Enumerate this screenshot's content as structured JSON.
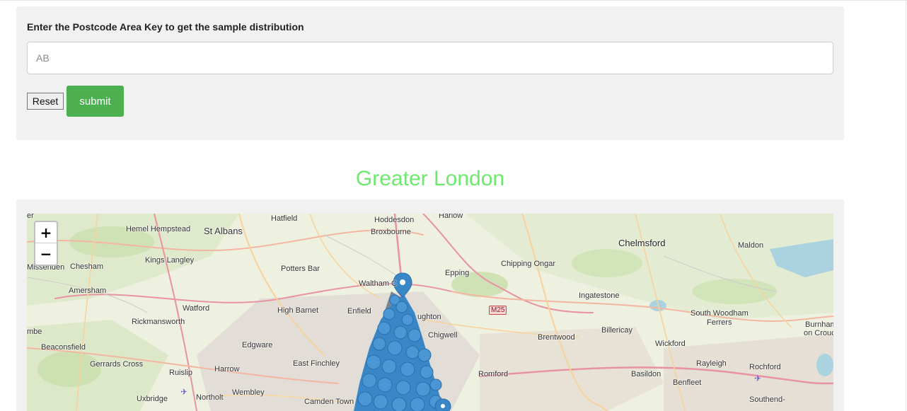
{
  "form": {
    "label": "Enter the Postcode Area Key to get the sample distribution",
    "input_placeholder": "AB",
    "input_value": "",
    "reset_label": "Reset",
    "submit_label": "submit"
  },
  "region_title": "Greater London",
  "colors": {
    "title": "#6ee86e",
    "submit": "#4caf50",
    "marker": "#3a87c8"
  },
  "map": {
    "zoom_in": "+",
    "zoom_out": "−",
    "road_label": "M25",
    "places": {
      "harlow": "Harlow",
      "hoddesdon": "Hoddesdon",
      "hatfield": "Hatfield",
      "hemel": "Hemel Hempstead",
      "st_albans": "St Albans",
      "broxbourne": "Broxbourne",
      "chelmsford": "Chelmsford",
      "maldon": "Maldon",
      "er": "er",
      "kings_langley": "Kings Langley",
      "missenden": "Missenden",
      "chesham": "Chesham",
      "potters_bar": "Potters Bar",
      "epping": "Epping",
      "chipping_ongar": "Chipping Ongar",
      "waltham": "Waltham C",
      "amersham": "Amersham",
      "ingatestone": "Ingatestone",
      "watford": "Watford",
      "high_barnet": "High Barnet",
      "enfield": "Enfield",
      "loughton": "ughton",
      "south_woodham": "South Woodham",
      "ferrers": "Ferrers",
      "burnham": "Burnham",
      "on_crouch": "on Crouch",
      "rickmansworth": "Rickmansworth",
      "chigwell": "Chigwell",
      "billericay": "Billericay",
      "brentwood": "Brentwood",
      "mbe": "mbe",
      "edgware": "Edgware",
      "beaconsfield": "Beaconsfield",
      "wickford": "Wickford",
      "east_finchley": "East Finchley",
      "rayleigh": "Rayleigh",
      "rochford": "Rochford",
      "gerrards_cross": "Gerrards Cross",
      "harrow": "Harrow",
      "romford": "Romford",
      "ruislip": "Ruislip",
      "basildon": "Basildon",
      "benfleet": "Benfleet",
      "wembley": "Wembley",
      "uxbridge": "Uxbridge",
      "northolt": "Northolt",
      "camden_town": "Camden Town",
      "southend": "Southend-"
    }
  }
}
